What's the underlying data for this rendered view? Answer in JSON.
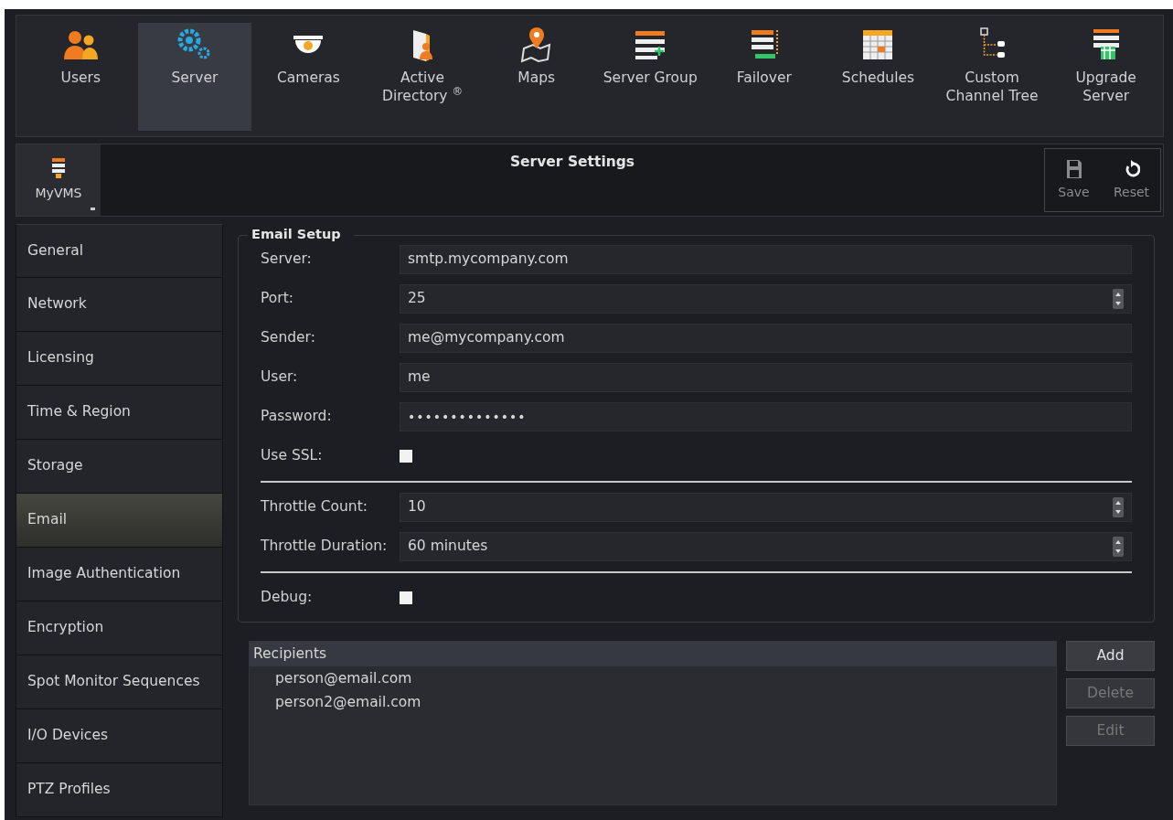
{
  "toolbar": {
    "items": [
      {
        "label": "Users",
        "selected": false
      },
      {
        "label": "Server",
        "selected": true
      },
      {
        "label": "Cameras",
        "selected": false
      },
      {
        "label": "Active Directory $^{®}$",
        "selected": false
      },
      {
        "label": "Maps",
        "selected": false
      },
      {
        "label": "Server Group",
        "selected": false
      },
      {
        "label": "Failover",
        "selected": false
      },
      {
        "label": "Schedules",
        "selected": false
      },
      {
        "label": "Custom Channel Tree",
        "selected": false
      },
      {
        "label": "Upgrade Server",
        "selected": false
      }
    ]
  },
  "header": {
    "server_selector": "MyVMS",
    "title": "Server Settings",
    "actions": [
      {
        "label": "Save",
        "disabled": true
      },
      {
        "label": "Reset",
        "disabled": false
      }
    ]
  },
  "sidebar": {
    "items": [
      {
        "label": "General",
        "selected": false
      },
      {
        "label": "Network",
        "selected": false
      },
      {
        "label": "Licensing",
        "selected": false
      },
      {
        "label": "Time & Region",
        "selected": false
      },
      {
        "label": "Storage",
        "selected": false
      },
      {
        "label": "Email",
        "selected": true
      },
      {
        "label": "Image Authentication",
        "selected": false
      },
      {
        "label": "Encryption",
        "selected": false
      },
      {
        "label": "Spot Monitor Sequences",
        "selected": false
      },
      {
        "label": "I/O Devices",
        "selected": false
      },
      {
        "label": "PTZ Profiles",
        "selected": false
      }
    ]
  },
  "email_setup": {
    "title": "Email Setup",
    "field_groups": [
      [
        {
          "label": "Server:",
          "kind": "text",
          "value": "smtp.mycompany.com"
        },
        {
          "label": "Port:",
          "kind": "spin",
          "value": "25"
        },
        {
          "label": "Sender:",
          "kind": "text",
          "value": "me@mycompany.com"
        },
        {
          "label": "User:",
          "kind": "text",
          "value": "me"
        },
        {
          "label": "Password:",
          "kind": "password",
          "value": "••••••••••••••"
        },
        {
          "label": "Use SSL:",
          "kind": "checkbox",
          "checked": false
        }
      ],
      [
        {
          "label": "Throttle Count:",
          "kind": "spin",
          "value": "10"
        },
        {
          "label": "Throttle Duration:",
          "kind": "spin",
          "value": "60 minutes"
        }
      ],
      [
        {
          "label": "Debug:",
          "kind": "checkbox",
          "checked": false
        }
      ]
    ]
  },
  "recipients": {
    "header": "Recipients",
    "items": [
      "person@email.com",
      "person2@email.com"
    ],
    "buttons": [
      {
        "label": "Add",
        "disabled": false
      },
      {
        "label": "Delete",
        "disabled": true
      },
      {
        "label": "Edit",
        "disabled": true
      }
    ]
  }
}
